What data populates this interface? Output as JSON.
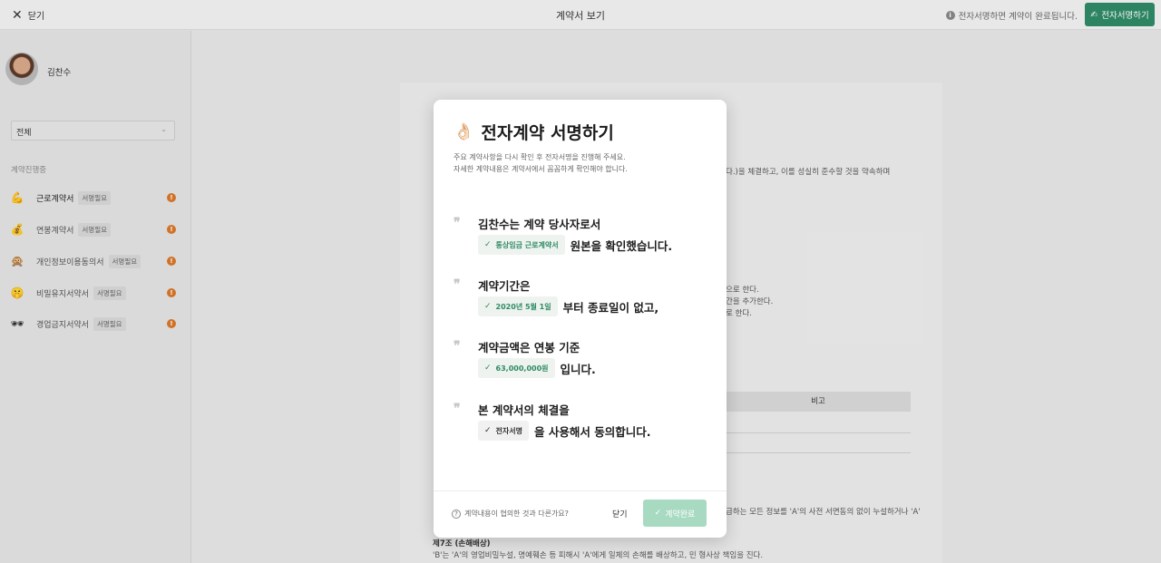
{
  "topbar": {
    "close_label": "닫기",
    "title": "계약서 보기",
    "notice": "전자서명하면 계약이 완료됩니다.",
    "sign_button": "전자서명하기"
  },
  "sidebar": {
    "user_name": "김찬수",
    "filter_value": "전체",
    "section_label": "계약진행중",
    "items": [
      {
        "emoji": "💪",
        "label": "근로계약서",
        "badge": "서명필요"
      },
      {
        "emoji": "💰",
        "label": "연봉계약서",
        "badge": "서명필요"
      },
      {
        "emoji": "🙊",
        "label": "개인정보이용동의서",
        "badge": "서명필요"
      },
      {
        "emoji": "🤫",
        "label": "비밀유지서약서",
        "badge": "서명필요"
      },
      {
        "emoji": "🕶",
        "label": "경업금지서약서",
        "badge": "서명필요"
      }
    ]
  },
  "background_doc": {
    "line1": "다.)을 체결하고, 이를 성실히 준수할 것을 약속하며",
    "line2": "으로 한다.",
    "line3": "간을 추가한다.",
    "line4": "로 한다.",
    "table_header": "비고",
    "line5": "급하는 모든 정보를 'A'의 사전 서면동의 없이 누설하거나 'A'",
    "article7_title": "제7조 (손해배상)",
    "article7_text": "'B'는 'A'의 영업비밀누설, 명예훼손 등 피해시 'A'에게 일체의 손해를 배상하고, 민 형사상 책임을 진다."
  },
  "modal": {
    "emoji": "👌🏻",
    "title": "전자계약 서명하기",
    "desc1": "주요 계약사항을 다시 확인 후 전자서명을 진행해 주세요.",
    "desc2": "자세한 계약내용은 계약서에서 꼼꼼하게 확인해야 합니다.",
    "clauses": [
      {
        "line1": "김찬수는 계약 당사자로서",
        "chip": "통상임금 근로계약서",
        "tail": "원본을 확인했습니다."
      },
      {
        "line1": "계약기간은",
        "chip": "2020년 5월 1일",
        "tail": "부터 종료일이 없고,"
      },
      {
        "line1": "계약금액은 연봉 기준",
        "chip": "63,000,000원",
        "tail": "입니다."
      },
      {
        "line1": "본 계약서의 체결을",
        "chip": "전자서명",
        "tail": "을 사용해서 동의합니다."
      }
    ],
    "help_link": "계약내용이 협의한 것과 다른가요?",
    "close_label": "닫기",
    "done_label": "계약완료"
  },
  "colors": {
    "accent": "#2f8a66",
    "accent_disabled": "#a8dac2",
    "alert": "#d9772b"
  }
}
